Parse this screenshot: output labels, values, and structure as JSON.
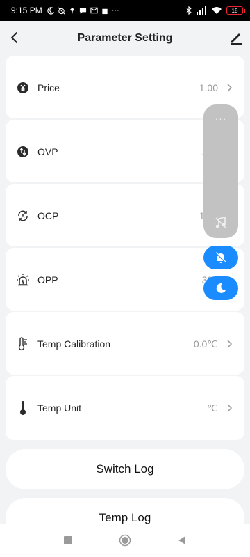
{
  "status_bar": {
    "time": "9:15 PM",
    "more": "···",
    "battery": "18",
    "battery_color": "#e23b3b"
  },
  "header": {
    "title": "Parameter Setting",
    "back_icon": "chevron-left-icon",
    "edit_icon": "pencil-icon"
  },
  "settings": [
    {
      "label": "Price",
      "value": "1.00",
      "icon": "yen-icon"
    },
    {
      "label": "OVP",
      "value": "265",
      "icon": "voltage-icon"
    },
    {
      "label": "OCP",
      "value": "10.0",
      "icon": "current-icon"
    },
    {
      "label": "OPP",
      "value": "300",
      "icon": "power-alarm-icon"
    },
    {
      "label": "Temp Calibration",
      "value": "0.0℃",
      "icon": "thermometer-calibration-icon"
    },
    {
      "label": "Temp Unit",
      "value": "℃",
      "icon": "thermometer-icon"
    }
  ],
  "buttons": {
    "switch_log": "Switch Log",
    "temp_log": "Temp Log"
  },
  "floating_panel": {
    "dots": "···",
    "accent": "#1a8cff"
  }
}
